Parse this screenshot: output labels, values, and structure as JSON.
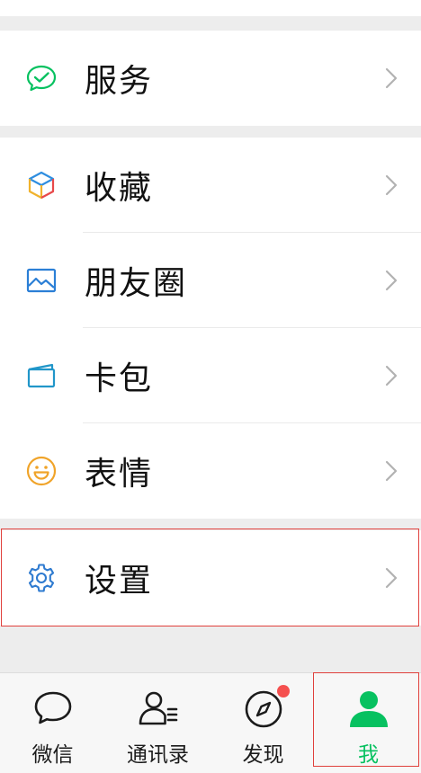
{
  "groups": [
    {
      "rows": [
        {
          "label": "服务",
          "icon": "service-icon"
        }
      ]
    },
    {
      "rows": [
        {
          "label": "收藏",
          "icon": "favorites-icon"
        },
        {
          "label": "朋友圈",
          "icon": "moments-icon"
        },
        {
          "label": "卡包",
          "icon": "card-wallet-icon"
        },
        {
          "label": "表情",
          "icon": "sticker-icon"
        }
      ]
    },
    {
      "rows": [
        {
          "label": "设置",
          "icon": "settings-icon"
        }
      ]
    }
  ],
  "tabbar": {
    "tabs": [
      {
        "label": "微信",
        "icon": "chat-bubble-icon"
      },
      {
        "label": "通讯录",
        "icon": "contacts-icon"
      },
      {
        "label": "发现",
        "icon": "compass-icon",
        "badge": "red-dot"
      },
      {
        "label": "我",
        "icon": "me-person-icon",
        "active": true
      }
    ]
  },
  "colors": {
    "accent_green": "#07c160",
    "badge_red": "#f5504f",
    "highlight_red": "#e0403c",
    "background": "#ededed",
    "settings_blue": "#2f7bd0"
  }
}
